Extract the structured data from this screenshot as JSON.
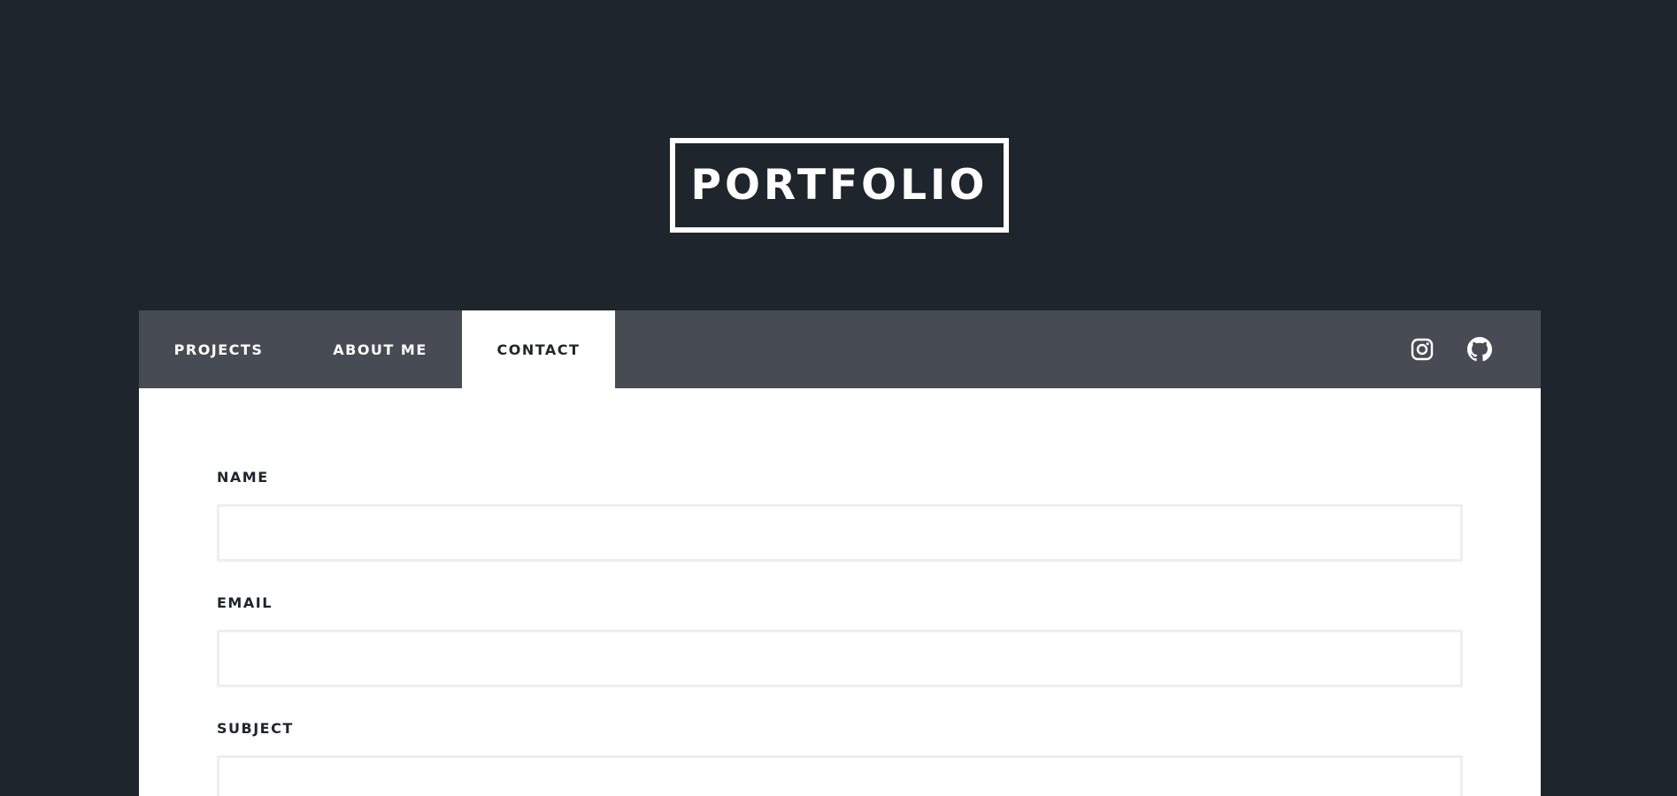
{
  "header": {
    "logo_text": "PORTFOLIO"
  },
  "nav": {
    "tabs": [
      {
        "label": "PROJECTS",
        "active": false
      },
      {
        "label": "ABOUT ME",
        "active": false
      },
      {
        "label": "CONTACT",
        "active": true
      }
    ],
    "social_icons": [
      "instagram-icon",
      "github-icon"
    ]
  },
  "contact_form": {
    "name_label": "NAME",
    "name_value": "",
    "email_label": "EMAIL",
    "email_value": "",
    "subject_label": "SUBJECT",
    "subject_value": ""
  },
  "colors": {
    "background": "#1f252d",
    "nav_background": "#474c54",
    "panel": "#ffffff",
    "input_border": "#eeeeee"
  }
}
